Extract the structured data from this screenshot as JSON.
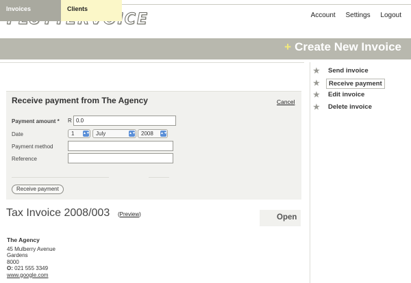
{
  "brand": {
    "logo": "FLUTTERVOICE"
  },
  "top_nav": {
    "account": "Account",
    "settings": "Settings",
    "logout": "Logout"
  },
  "tabs": {
    "invoices": "Invoices",
    "clients": "Clients"
  },
  "create_new": {
    "plus": "+",
    "label": "Create New Invoice"
  },
  "actions": [
    {
      "label": "Send invoice"
    },
    {
      "label": "Receive payment"
    },
    {
      "label": "Edit invoice"
    },
    {
      "label": "Delete invoice"
    }
  ],
  "payment_form": {
    "title": "Receive payment from The Agency",
    "cancel": "Cancel",
    "amount_label": "Payment amount *",
    "currency": "R",
    "amount_value": "0.0",
    "date_label": "Date",
    "day": "1",
    "month": "July",
    "year": "2008",
    "method_label": "Payment method",
    "method_value": "",
    "reference_label": "Reference",
    "reference_value": "",
    "submit": "Receive payment"
  },
  "invoice": {
    "title": "Tax Invoice 2008/003",
    "preview_open": "(",
    "preview": "Preview",
    "preview_close": ")",
    "status": "Open"
  },
  "client": {
    "name": "The Agency",
    "street": "45 Mulberry Avenue",
    "suburb": "Gardens",
    "postcode": "8000",
    "phone_prefix": "O:",
    "phone": "021 555 3349",
    "website": "www.google.com"
  }
}
